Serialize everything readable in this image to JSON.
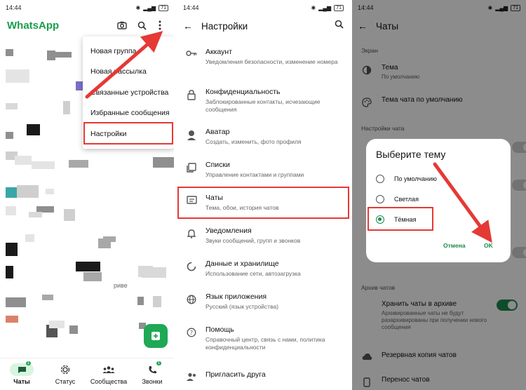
{
  "status_time": "14:44",
  "battery": "71",
  "panel1": {
    "app_title": "WhatsApp",
    "menu_items": [
      "Новая группа",
      "Новая рассылка",
      "Связанные устройства",
      "Избранные сообщения",
      "Настройки"
    ],
    "partial_chat_text": "риве",
    "bottom_tabs": [
      {
        "label": "Чаты",
        "badge": "1"
      },
      {
        "label": "Статус",
        "badge": ""
      },
      {
        "label": "Сообщества",
        "badge": ""
      },
      {
        "label": "Звонки",
        "badge": "1"
      }
    ]
  },
  "panel2": {
    "title": "Настройки",
    "items": [
      {
        "title": "Аккаунт",
        "sub": "Уведомления безопасности, изменение номера",
        "icon": "key-icon"
      },
      {
        "title": "Конфиденциальность",
        "sub": "Заблокированные контакты, исчезающие сообщения",
        "icon": "lock-icon"
      },
      {
        "title": "Аватар",
        "sub": "Создать, изменить, фото профиля",
        "icon": "avatar-icon"
      },
      {
        "title": "Списки",
        "sub": "Управление контактами и группами",
        "icon": "lists-icon"
      },
      {
        "title": "Чаты",
        "sub": "Тема, обои, история чатов",
        "icon": "chat-icon"
      },
      {
        "title": "Уведомления",
        "sub": "Звуки сообщений, групп и звонков",
        "icon": "bell-icon"
      },
      {
        "title": "Данные и хранилище",
        "sub": "Использование сети, автозагрузка",
        "icon": "data-icon"
      },
      {
        "title": "Язык приложения",
        "sub": "Русский (язык устройства)",
        "icon": "globe-icon"
      },
      {
        "title": "Помощь",
        "sub": "Справочный центр, связь с нами, политика конфиденциальности",
        "icon": "help-icon"
      },
      {
        "title": "Пригласить друга",
        "sub": "",
        "icon": "invite-icon"
      }
    ]
  },
  "panel3": {
    "title": "Чаты",
    "section_screen": "Экран",
    "theme_title": "Тема",
    "theme_sub": "По умолчанию",
    "chat_theme_title": "Тема чата по умолчанию",
    "section_chat_settings": "Настройки чата",
    "section_archive": "Архив чатов",
    "archive_title": "Хранить чаты в архиве",
    "archive_sub": "Архивированные чаты не будут разархивированы при получении нового сообщения",
    "backup": "Резервная копия чатов",
    "transfer": "Перенос чатов",
    "dialog": {
      "title": "Выберите тему",
      "options": [
        "По умолчанию",
        "Светлая",
        "Тёмная"
      ],
      "selected": "Тёмная",
      "cancel": "Отмена",
      "ok": "OK"
    }
  },
  "colors": {
    "accent": "#1c9d4d",
    "highlight": "#e53935"
  }
}
